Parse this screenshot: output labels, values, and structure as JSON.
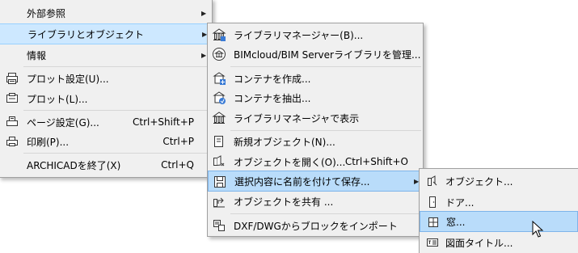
{
  "menu_main": {
    "items": [
      {
        "label": "外部参照",
        "submenu": true,
        "icon": ""
      },
      {
        "label": "ライブラリとオブジェクト",
        "submenu": true,
        "icon": ""
      },
      {
        "label": "情報",
        "submenu": true,
        "icon": ""
      },
      {
        "label": "プロット設定(U)...",
        "icon": "plot-setup-icon"
      },
      {
        "label": "プロット(L)...",
        "icon": "plotter-icon"
      },
      {
        "label": "ページ設定(G)...",
        "shortcut": "Ctrl+Shift+P",
        "icon": "page-setup-icon"
      },
      {
        "label": "印刷(P)...",
        "shortcut": "Ctrl+P",
        "icon": "printer-icon"
      },
      {
        "label": "ARCHICADを終了(X)",
        "shortcut": "Ctrl+Q",
        "icon": ""
      }
    ]
  },
  "menu_library": {
    "items": [
      {
        "label": "ライブラリマネージャー(B)...",
        "icon": "library-manager-icon"
      },
      {
        "label": "BIMcloud/BIM Serverライブラリを管理...",
        "icon": "bimcloud-library-icon"
      },
      {
        "label": "コンテナを作成...",
        "icon": "create-container-icon"
      },
      {
        "label": "コンテナを抽出...",
        "icon": "extract-container-icon"
      },
      {
        "label": "ライブラリマネージャで表示",
        "icon": "show-in-library-manager-icon"
      },
      {
        "label": "新規オブジェクト(N)...",
        "icon": "new-object-icon"
      },
      {
        "label": "オブジェクトを開く(O)...",
        "shortcut": "Ctrl+Shift+O",
        "icon": "open-object-icon"
      },
      {
        "label": "選択内容に名前を付けて保存...",
        "submenu": true,
        "icon": "save-as-icon"
      },
      {
        "label": "オブジェクトを共有 ...",
        "icon": "share-object-icon"
      },
      {
        "label": "DXF/DWGからブロックをインポート",
        "icon": "import-block-icon"
      }
    ]
  },
  "menu_save_as": {
    "items": [
      {
        "label": "オブジェクト...",
        "icon": "object-icon"
      },
      {
        "label": "ドア...",
        "icon": "door-icon"
      },
      {
        "label": "窓...",
        "icon": "window-icon"
      },
      {
        "label": "図面タイトル...",
        "icon": "drawing-title-icon"
      }
    ]
  }
}
